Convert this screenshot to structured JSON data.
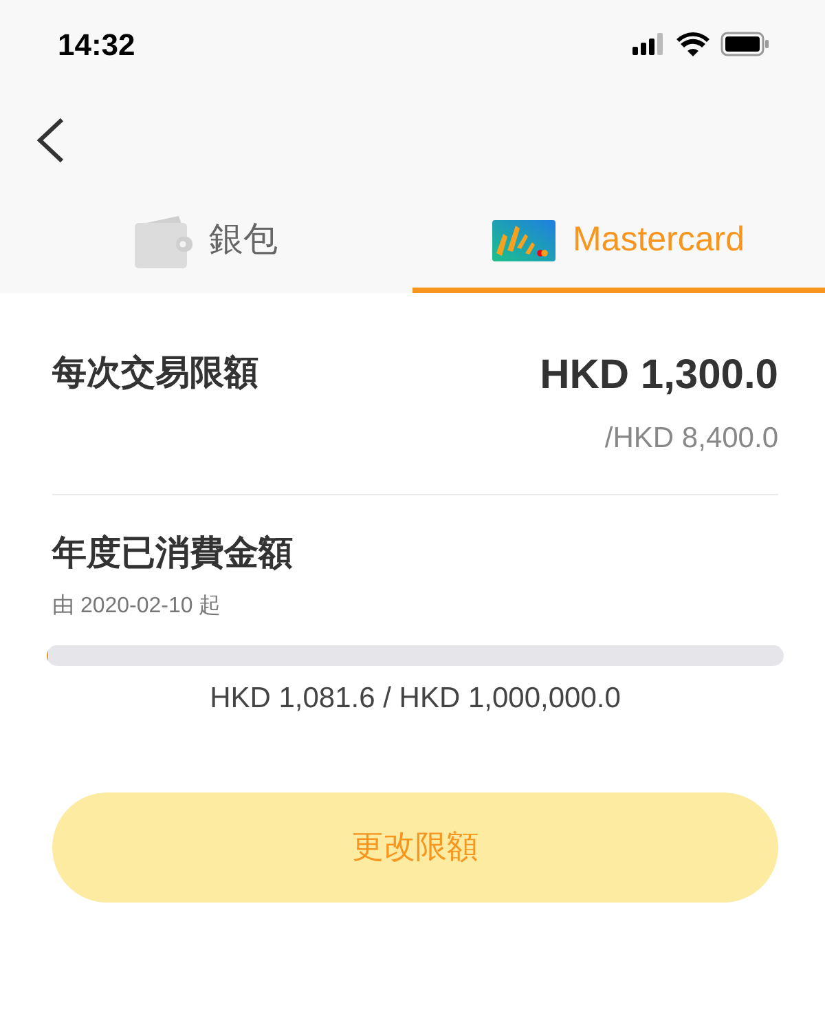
{
  "status_bar": {
    "time": "14:32"
  },
  "tabs": [
    {
      "label": "銀包",
      "kind": "wallet",
      "selected": false
    },
    {
      "label": "Mastercard",
      "kind": "card",
      "selected": true
    }
  ],
  "transaction_limit": {
    "label": "每次交易限額",
    "amount": "HKD 1,300.0",
    "max": "/HKD 8,400.0"
  },
  "annual_spending": {
    "label": "年度已消費金額",
    "since": "由 2020-02-10 起",
    "level": 0.001,
    "reading": "HKD 1,081.6 / HKD 1,000,000.0"
  },
  "button": "更改限額"
}
